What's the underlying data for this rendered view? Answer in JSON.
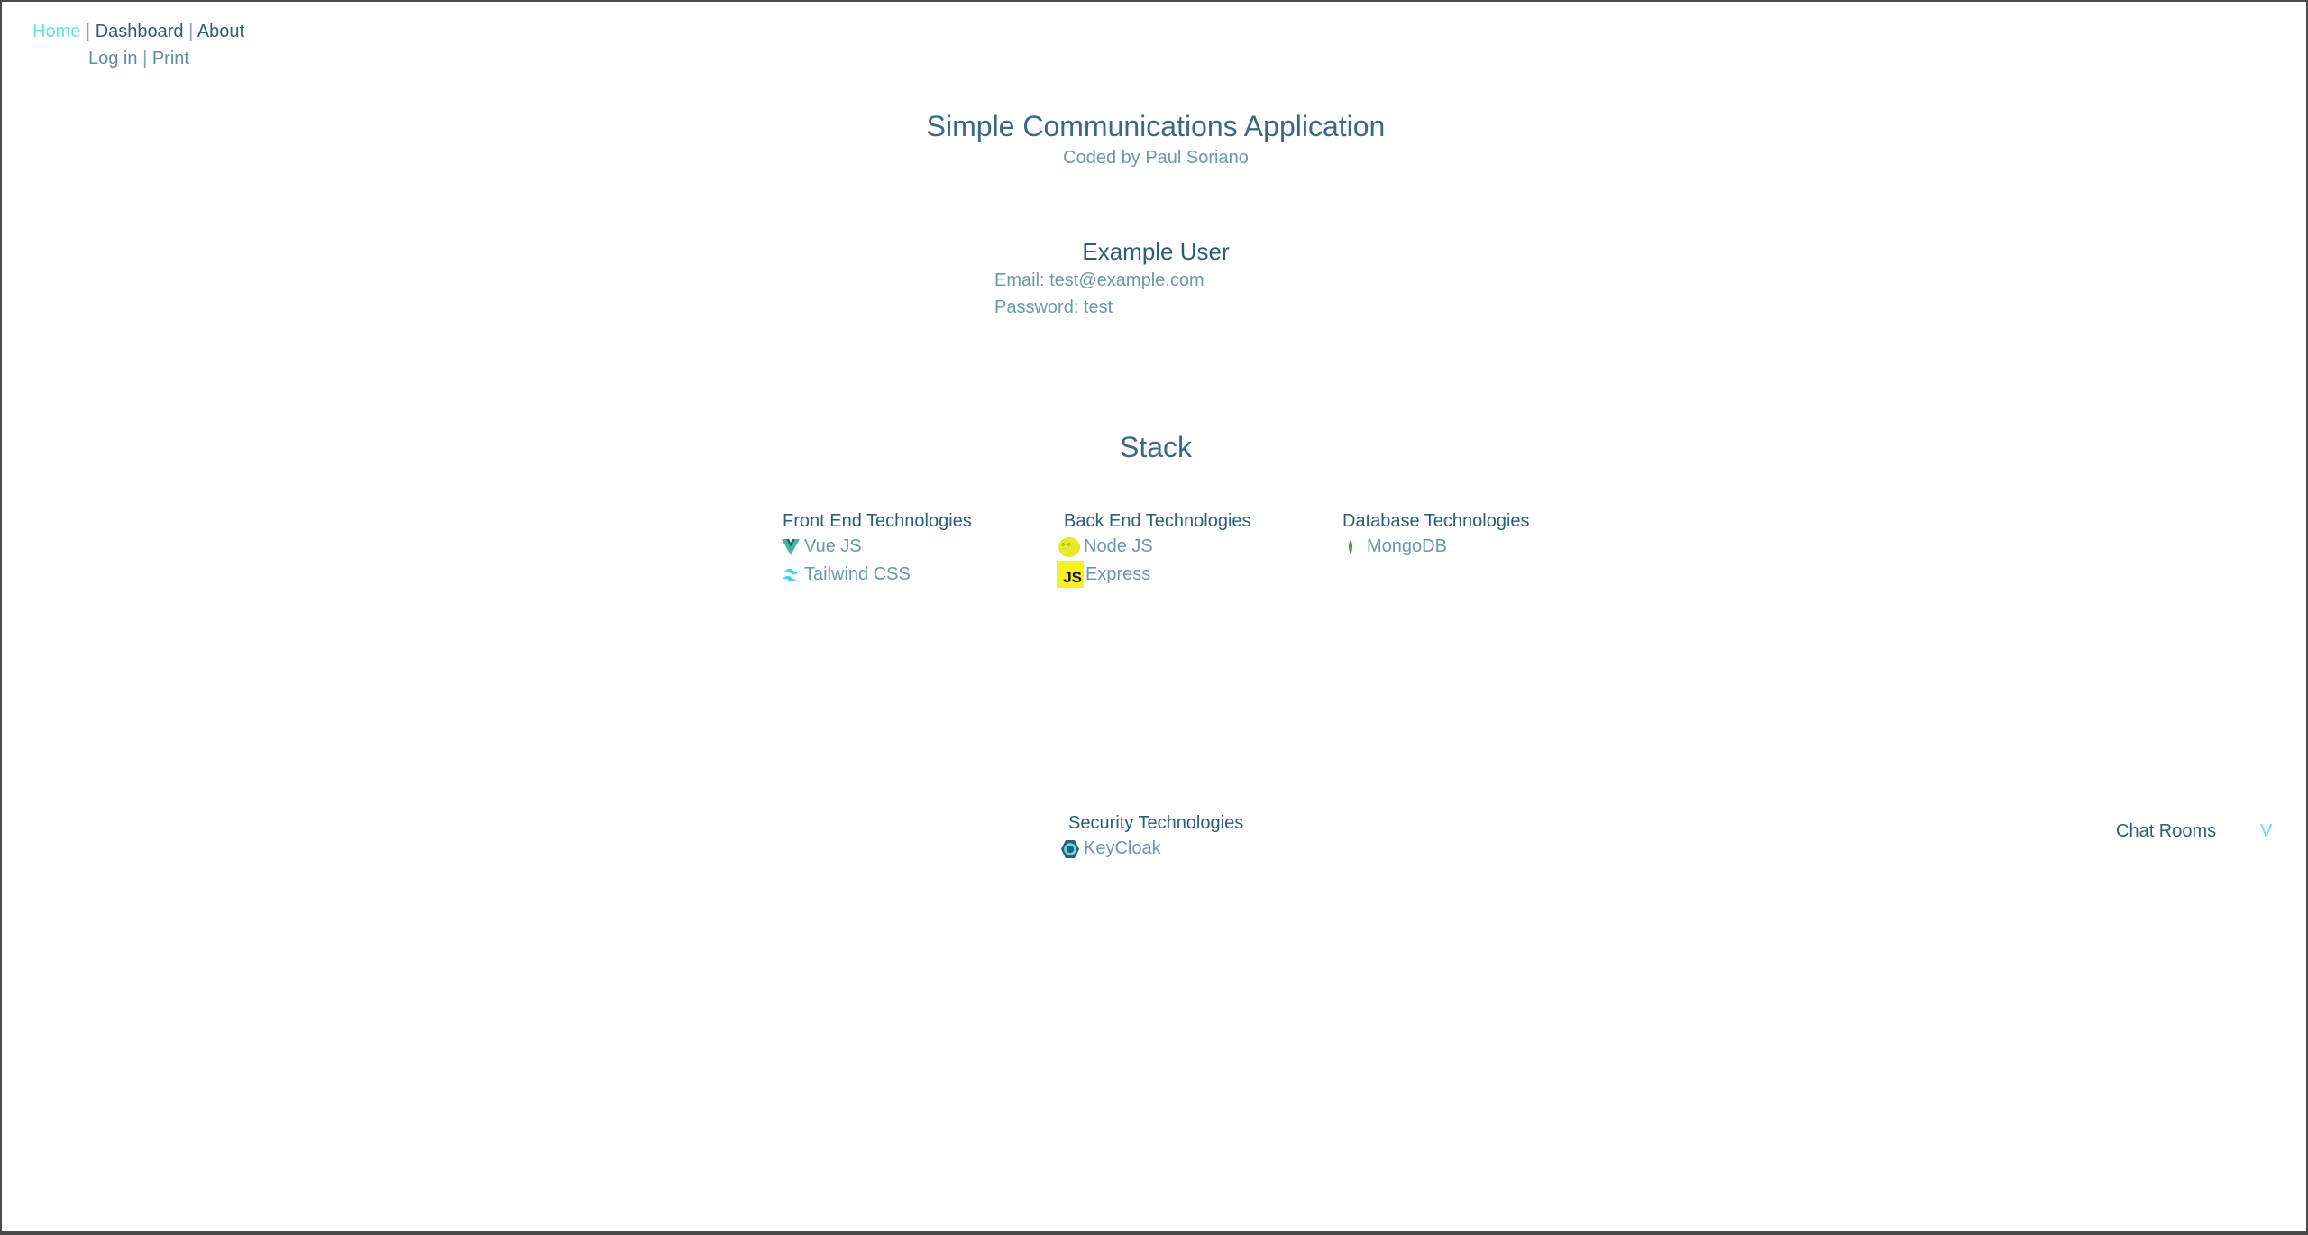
{
  "nav": {
    "primary": [
      {
        "label": "Home",
        "active": true
      },
      {
        "label": "Dashboard",
        "active": false
      },
      {
        "label": "About",
        "active": false
      }
    ],
    "separator": "|",
    "secondary": [
      {
        "label": "Log in"
      },
      {
        "label": "Print"
      }
    ]
  },
  "header": {
    "title": "Simple Communications Application",
    "subtitle": "Coded by Paul Soriano"
  },
  "example_user": {
    "heading": "Example User",
    "email": "Email: test@example.com",
    "password": "Password: test"
  },
  "stack": {
    "title": "Stack",
    "front_end": {
      "heading": "Front End Technologies",
      "items": [
        {
          "label": "Vue JS",
          "icon": "vue-icon"
        },
        {
          "label": "Tailwind CSS",
          "icon": "tailwind-icon"
        }
      ]
    },
    "back_end": {
      "heading": "Back End Technologies",
      "items": [
        {
          "label": "Node JS",
          "icon": "node-icon"
        },
        {
          "label": "Express",
          "icon": "js-icon",
          "icon_text": "JS"
        }
      ]
    },
    "database": {
      "heading": "Database Technologies",
      "items": [
        {
          "label": "MongoDB",
          "icon": "mongodb-icon"
        }
      ]
    },
    "security": {
      "heading": "Security Technologies",
      "items": [
        {
          "label": "KeyCloak",
          "icon": "keycloak-icon"
        }
      ]
    }
  },
  "chat_rooms": {
    "label": "Chat Rooms",
    "toggle_glyph": "V"
  },
  "colors": {
    "accent": "#5fe1ee",
    "text_dark": "#2c5e77",
    "text_light": "#6a98ad"
  }
}
